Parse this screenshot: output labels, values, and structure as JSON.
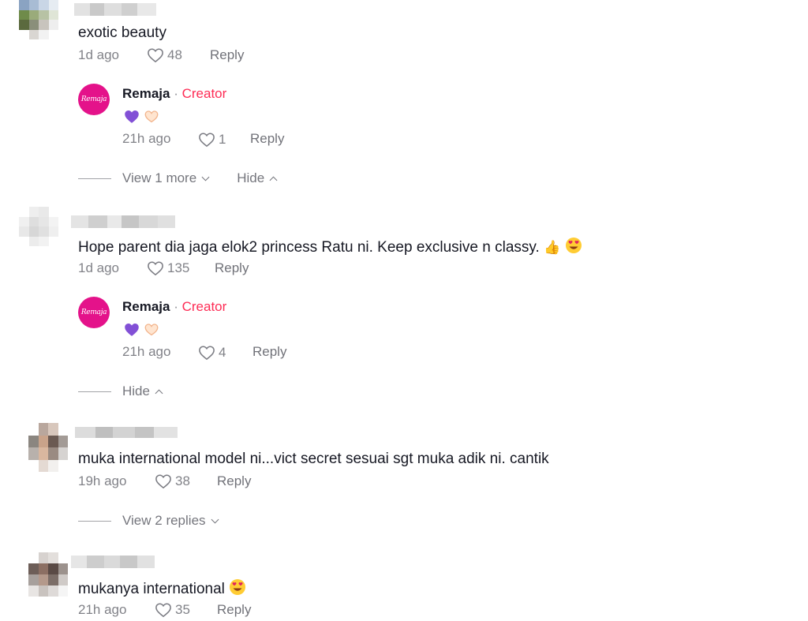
{
  "comments": [
    {
      "text": "exotic beauty",
      "time": "1d ago",
      "likes": "48",
      "reply_label": "Reply",
      "replies": [
        {
          "author": "Remaja",
          "separator": " · ",
          "badge": "Creator",
          "time": "21h ago",
          "likes": "1",
          "reply_label": "Reply"
        }
      ],
      "view_more": "View 1 more",
      "hide": "Hide"
    },
    {
      "text": "Hope parent dia jaga elok2 princess Ratu ni. Keep exclusive n classy.",
      "time": "1d ago",
      "likes": "135",
      "reply_label": "Reply",
      "replies": [
        {
          "author": "Remaja",
          "separator": " · ",
          "badge": "Creator",
          "time": "21h ago",
          "likes": "4",
          "reply_label": "Reply"
        }
      ],
      "hide": "Hide"
    },
    {
      "text": "muka international model ni...vict secret sesuai sgt muka adik ni. cantik",
      "time": "19h ago",
      "likes": "38",
      "reply_label": "Reply",
      "view_replies": "View 2 replies"
    },
    {
      "text": "mukanya international",
      "time": "21h ago",
      "likes": "35",
      "reply_label": "Reply"
    }
  ],
  "creator_logo_text": "Remaja",
  "colors": {
    "creator_badge": "#fe2c55",
    "creator_avatar": "#e4128a",
    "text": "#161823",
    "muted": "#8a8b91"
  },
  "icons": {
    "like": "heart-outline-icon",
    "expand": "chevron-down-icon",
    "collapse": "chevron-up-icon",
    "reaction_1": "purple-heart-emoji",
    "reaction_2": "heart-hands-emoji",
    "thumbs_up": "thumbs-up-emoji",
    "heart_eyes": "heart-eyes-emoji"
  }
}
